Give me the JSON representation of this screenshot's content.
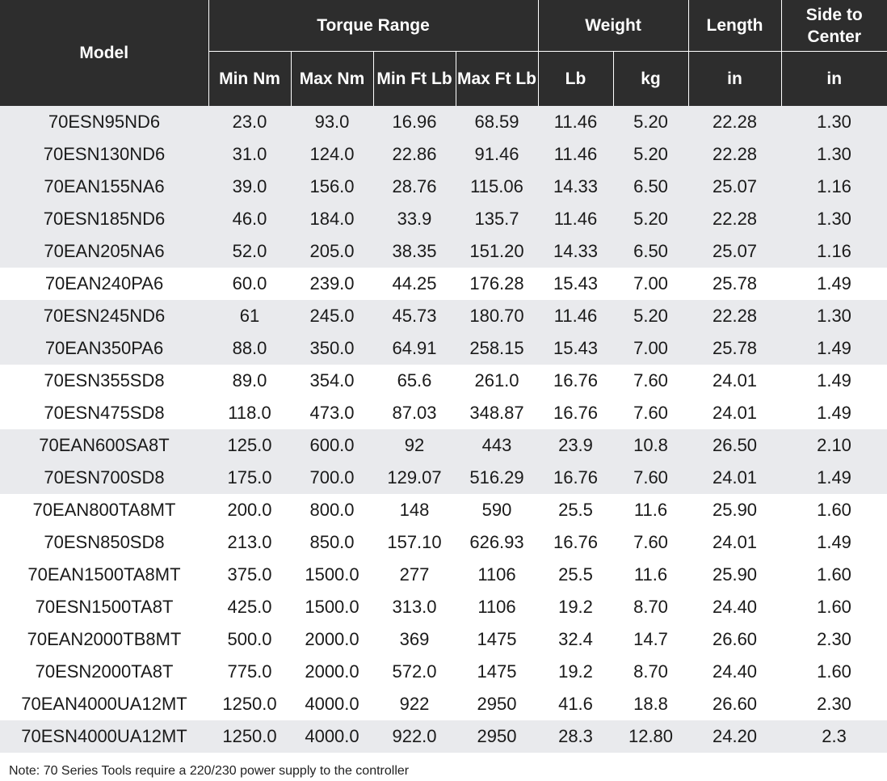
{
  "headers": {
    "model": "Model",
    "torque_range": "Torque Range",
    "weight": "Weight",
    "length": "Length",
    "side_to_center": "Side to Center",
    "min_nm": "Min Nm",
    "max_nm": "Max Nm",
    "min_ft_lb": "Min Ft Lb",
    "max_ft_lb": "Max Ft Lb",
    "lb": "Lb",
    "kg": "kg",
    "length_unit": "in",
    "side_unit": "in"
  },
  "rows": [
    {
      "model": "70ESN95ND6",
      "min_nm": "23.0",
      "max_nm": "93.0",
      "min_ft_lb": "16.96",
      "max_ft_lb": "68.59",
      "lb": "11.46",
      "kg": "5.20",
      "length": "22.28",
      "side": "1.30",
      "shade": "alt"
    },
    {
      "model": "70ESN130ND6",
      "min_nm": "31.0",
      "max_nm": "124.0",
      "min_ft_lb": "22.86",
      "max_ft_lb": "91.46",
      "lb": "11.46",
      "kg": "5.20",
      "length": "22.28",
      "side": "1.30",
      "shade": "alt"
    },
    {
      "model": "70EAN155NA6",
      "min_nm": "39.0",
      "max_nm": "156.0",
      "min_ft_lb": "28.76",
      "max_ft_lb": "115.06",
      "lb": "14.33",
      "kg": "6.50",
      "length": "25.07",
      "side": "1.16",
      "shade": "alt"
    },
    {
      "model": "70ESN185ND6",
      "min_nm": "46.0",
      "max_nm": "184.0",
      "min_ft_lb": "33.9",
      "max_ft_lb": "135.7",
      "lb": "11.46",
      "kg": "5.20",
      "length": "22.28",
      "side": "1.30",
      "shade": "alt"
    },
    {
      "model": "70EAN205NA6",
      "min_nm": "52.0",
      "max_nm": "205.0",
      "min_ft_lb": "38.35",
      "max_ft_lb": "151.20",
      "lb": "14.33",
      "kg": "6.50",
      "length": "25.07",
      "side": "1.16",
      "shade": "alt"
    },
    {
      "model": "70EAN240PA6",
      "min_nm": "60.0",
      "max_nm": "239.0",
      "min_ft_lb": "44.25",
      "max_ft_lb": "176.28",
      "lb": "15.43",
      "kg": "7.00",
      "length": "25.78",
      "side": "1.49",
      "shade": "plain"
    },
    {
      "model": "70ESN245ND6",
      "min_nm": "61",
      "max_nm": "245.0",
      "min_ft_lb": "45.73",
      "max_ft_lb": "180.70",
      "lb": "11.46",
      "kg": "5.20",
      "length": "22.28",
      "side": "1.30",
      "shade": "alt"
    },
    {
      "model": "70EAN350PA6",
      "min_nm": "88.0",
      "max_nm": "350.0",
      "min_ft_lb": "64.91",
      "max_ft_lb": "258.15",
      "lb": "15.43",
      "kg": "7.00",
      "length": "25.78",
      "side": "1.49",
      "shade": "alt"
    },
    {
      "model": "70ESN355SD8",
      "min_nm": "89.0",
      "max_nm": "354.0",
      "min_ft_lb": "65.6",
      "max_ft_lb": "261.0",
      "lb": "16.76",
      "kg": "7.60",
      "length": "24.01",
      "side": "1.49",
      "shade": "plain"
    },
    {
      "model": "70ESN475SD8",
      "min_nm": "118.0",
      "max_nm": "473.0",
      "min_ft_lb": "87.03",
      "max_ft_lb": "348.87",
      "lb": "16.76",
      "kg": "7.60",
      "length": "24.01",
      "side": "1.49",
      "shade": "plain"
    },
    {
      "model": "70EAN600SA8T",
      "min_nm": "125.0",
      "max_nm": "600.0",
      "min_ft_lb": "92",
      "max_ft_lb": "443",
      "lb": "23.9",
      "kg": "10.8",
      "length": "26.50",
      "side": "2.10",
      "shade": "alt"
    },
    {
      "model": "70ESN700SD8",
      "min_nm": "175.0",
      "max_nm": "700.0",
      "min_ft_lb": "129.07",
      "max_ft_lb": "516.29",
      "lb": "16.76",
      "kg": "7.60",
      "length": "24.01",
      "side": "1.49",
      "shade": "alt"
    },
    {
      "model": "70EAN800TA8MT",
      "min_nm": "200.0",
      "max_nm": "800.0",
      "min_ft_lb": "148",
      "max_ft_lb": "590",
      "lb": "25.5",
      "kg": "11.6",
      "length": "25.90",
      "side": "1.60",
      "shade": "plain"
    },
    {
      "model": "70ESN850SD8",
      "min_nm": "213.0",
      "max_nm": "850.0",
      "min_ft_lb": "157.10",
      "max_ft_lb": "626.93",
      "lb": "16.76",
      "kg": "7.60",
      "length": "24.01",
      "side": "1.49",
      "shade": "plain"
    },
    {
      "model": "70EAN1500TA8MT",
      "min_nm": "375.0",
      "max_nm": "1500.0",
      "min_ft_lb": "277",
      "max_ft_lb": "1106",
      "lb": "25.5",
      "kg": "11.6",
      "length": "25.90",
      "side": "1.60",
      "shade": "plain"
    },
    {
      "model": "70ESN1500TA8T",
      "min_nm": "425.0",
      "max_nm": "1500.0",
      "min_ft_lb": "313.0",
      "max_ft_lb": "1106",
      "lb": "19.2",
      "kg": "8.70",
      "length": "24.40",
      "side": "1.60",
      "shade": "plain"
    },
    {
      "model": "70EAN2000TB8MT",
      "min_nm": "500.0",
      "max_nm": "2000.0",
      "min_ft_lb": "369",
      "max_ft_lb": "1475",
      "lb": "32.4",
      "kg": "14.7",
      "length": "26.60",
      "side": "2.30",
      "shade": "plain"
    },
    {
      "model": "70ESN2000TA8T",
      "min_nm": "775.0",
      "max_nm": "2000.0",
      "min_ft_lb": "572.0",
      "max_ft_lb": "1475",
      "lb": "19.2",
      "kg": "8.70",
      "length": "24.40",
      "side": "1.60",
      "shade": "plain"
    },
    {
      "model": "70EAN4000UA12MT",
      "min_nm": "1250.0",
      "max_nm": "4000.0",
      "min_ft_lb": "922",
      "max_ft_lb": "2950",
      "lb": "41.6",
      "kg": "18.8",
      "length": "26.60",
      "side": "2.30",
      "shade": "plain"
    },
    {
      "model": "70ESN4000UA12MT",
      "min_nm": "1250.0",
      "max_nm": "4000.0",
      "min_ft_lb": "922.0",
      "max_ft_lb": "2950",
      "lb": "28.3",
      "kg": "12.80",
      "length": "24.20",
      "side": "2.3",
      "shade": "alt"
    }
  ],
  "note": "Note: 70 Series Tools require a 220/230 power supply to the controller",
  "colors": {
    "header_bg": "#2d2d2d",
    "header_text": "#ffffff",
    "row_alt": "#e9eaed",
    "row_plain": "#ffffff"
  }
}
